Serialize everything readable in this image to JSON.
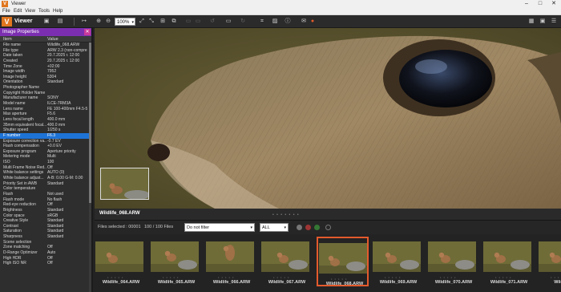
{
  "window": {
    "title": "Viewer",
    "logo": "V",
    "minimize": "–",
    "maximize": "□",
    "close": "✕"
  },
  "menu": [
    "File",
    "Edit",
    "View",
    "Tools",
    "Help"
  ],
  "toolbar": {
    "app_name": "Viewer",
    "logo": "V",
    "zoom_value": "100%"
  },
  "sidebar": {
    "title": "Image Properties",
    "close": "✕",
    "col_item": "Item",
    "col_value": "Value",
    "selected_index": 19,
    "rows": [
      {
        "k": "File name",
        "v": "Wildlife_068.ARW"
      },
      {
        "k": "File type",
        "v": "ARW 2.3 (non-compre"
      },
      {
        "k": "Date taken",
        "v": "20.7.2025 г. 12:00"
      },
      {
        "k": "Created",
        "v": "20.7.2025 г. 12:00"
      },
      {
        "k": "Time Zone",
        "v": "+02:00"
      },
      {
        "k": "Image width",
        "v": "7952"
      },
      {
        "k": "Image height",
        "v": "5304"
      },
      {
        "k": "Orientation",
        "v": "Standard"
      },
      {
        "k": "Photographer Name",
        "v": ""
      },
      {
        "k": "Copyright Holder Name",
        "v": ""
      },
      {
        "k": "Manufacturer name",
        "v": "SONY"
      },
      {
        "k": "Model name",
        "v": "ILCE-7RM3A"
      },
      {
        "k": "Lens name",
        "v": "FE 100-400mm F4.5-5."
      },
      {
        "k": "Max aperture",
        "v": "F5.6"
      },
      {
        "k": "Lens focal length",
        "v": "400.0 mm"
      },
      {
        "k": "35mm equivalent focal...",
        "v": "400.0 mm"
      },
      {
        "k": "Shutter speed",
        "v": "1/250 s"
      },
      {
        "k": "F number",
        "v": "F6.3"
      },
      {
        "k": "Exposure correction va...",
        "v": "-0.7 EV"
      },
      {
        "k": "Flash compensation",
        "v": "+0.0 EV"
      },
      {
        "k": "Exposure program",
        "v": "Aperture priority"
      },
      {
        "k": "Metering mode",
        "v": "Multi"
      },
      {
        "k": "ISO",
        "v": "100"
      },
      {
        "k": "Multi Frame Noise Red...",
        "v": "Off"
      },
      {
        "k": "White balance settings",
        "v": "AUTO (0)"
      },
      {
        "k": "White balance adjust...",
        "v": "A-B: 0.00 G-M: 0.00"
      },
      {
        "k": "Priority Set in AWB",
        "v": "Standard"
      },
      {
        "k": "Color temperature",
        "v": ""
      },
      {
        "k": "Flash",
        "v": "Not used"
      },
      {
        "k": "Flash mode",
        "v": "No flash"
      },
      {
        "k": "Red-eye reduction",
        "v": "Off"
      },
      {
        "k": "Brightness",
        "v": "Standard"
      },
      {
        "k": "Color space",
        "v": "sRGB"
      },
      {
        "k": "Creative Style",
        "v": "Standard"
      },
      {
        "k": "Contrast",
        "v": "Standard"
      },
      {
        "k": "Saturation",
        "v": "Standard"
      },
      {
        "k": "Sharpness",
        "v": "Standard"
      },
      {
        "k": "Scene selection",
        "v": ""
      },
      {
        "k": "Zone matching",
        "v": "Off"
      },
      {
        "k": "D-Range Optimizer",
        "v": "Auto"
      },
      {
        "k": "High HDR",
        "v": "Off"
      },
      {
        "k": "High ISO NR",
        "v": "Off"
      }
    ]
  },
  "viewer": {
    "file_name": "Wildlife_068.ARW",
    "dots": "• • • • • • •"
  },
  "filter": {
    "selected_label": "Files selected : 00001",
    "count_label": "100 / 100 Files",
    "filter_value": "Do not filter",
    "filter_arrow": "▾",
    "group_value": "ALL",
    "group_arrow": "▾"
  },
  "thumbnails": [
    {
      "name": "Wildlife_064.ARW",
      "selected": false
    },
    {
      "name": "Wildlife_065.ARW",
      "selected": false
    },
    {
      "name": "Wildlife_066.ARW",
      "selected": false
    },
    {
      "name": "Wildlife_067.ARW",
      "selected": false
    },
    {
      "name": "Wildlife_068.ARW",
      "selected": true
    },
    {
      "name": "Wildlife_069.ARW",
      "selected": false
    },
    {
      "name": "Wildlife_070.ARW",
      "selected": false
    },
    {
      "name": "Wildlife_071.ARW",
      "selected": false
    },
    {
      "name": "Wildlife_0",
      "selected": false
    }
  ],
  "icons": {
    "accent": "#e0761e",
    "sidebar_header": "#7b2fb0",
    "selection": "#1e73d6",
    "thumb_border": "#e45a2c"
  }
}
